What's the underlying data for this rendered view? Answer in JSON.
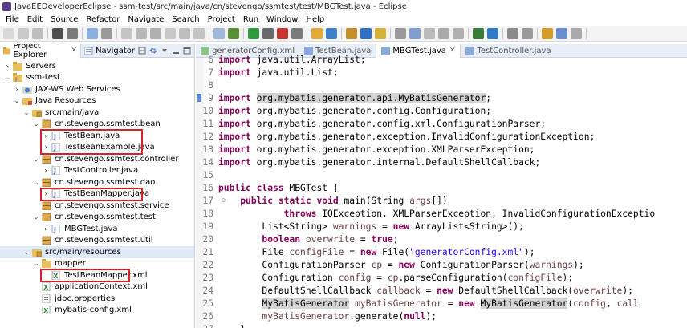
{
  "window": {
    "title": "JavaEEDeveloperEclipse - ssm-test/src/main/java/cn/stevengo/ssmtest/test/MBGTest.java - Eclipse"
  },
  "menu": [
    "File",
    "Edit",
    "Source",
    "Refactor",
    "Navigate",
    "Search",
    "Project",
    "Run",
    "Window",
    "Help"
  ],
  "left_panel": {
    "tabs": [
      {
        "label": "Project Explorer",
        "close": "✕"
      },
      {
        "label": "Navigator"
      }
    ],
    "tree": [
      {
        "label": "Servers",
        "twisty": "›",
        "icon": "folder"
      },
      {
        "label": "ssm-test",
        "twisty": "⌄",
        "icon": "project"
      },
      {
        "label": "JAX-WS Web Services",
        "twisty": "›",
        "icon": "ws"
      },
      {
        "label": "Java Resources",
        "twisty": "⌄",
        "icon": "jres"
      },
      {
        "label": "src/main/java",
        "twisty": "⌄",
        "icon": "srcfolder"
      },
      {
        "label": "cn.stevengo.ssmtest.bean",
        "twisty": "⌄",
        "icon": "package"
      },
      {
        "label": "TestBean.java",
        "twisty": "›",
        "icon": "java"
      },
      {
        "label": "TestBeanExample.java",
        "twisty": "›",
        "icon": "java"
      },
      {
        "label": "cn.stevengo.ssmtest.controller",
        "twisty": "⌄",
        "icon": "package"
      },
      {
        "label": "TestController.java",
        "twisty": "›",
        "icon": "java"
      },
      {
        "label": "cn.stevengo.ssmtest.dao",
        "twisty": "⌄",
        "icon": "package"
      },
      {
        "label": "TestBeanMapper.java",
        "twisty": "›",
        "icon": "java"
      },
      {
        "label": "cn.stevengo.ssmtest.service",
        "twisty": "",
        "icon": "package"
      },
      {
        "label": "cn.stevengo.ssmtest.test",
        "twisty": "⌄",
        "icon": "package"
      },
      {
        "label": "MBGTest.java",
        "twisty": "›",
        "icon": "java"
      },
      {
        "label": "cn.stevengo.ssmtest.util",
        "twisty": "",
        "icon": "package"
      },
      {
        "label": "src/main/resources",
        "twisty": "⌄",
        "icon": "srcfolder"
      },
      {
        "label": "mapper",
        "twisty": "⌄",
        "icon": "folder"
      },
      {
        "label": "TestBeanMapper.xml",
        "twisty": "",
        "icon": "xml"
      },
      {
        "label": "applicationContext.xml",
        "twisty": "",
        "icon": "xml"
      },
      {
        "label": "jdbc.properties",
        "twisty": "",
        "icon": "props"
      },
      {
        "label": "mybatis-config.xml",
        "twisty": "",
        "icon": "xml"
      }
    ]
  },
  "editor": {
    "tabs": [
      {
        "label": "generatorConfig.xml",
        "icon": "xml"
      },
      {
        "label": "TestBean.java",
        "icon": "java"
      },
      {
        "label": "MBGTest.java",
        "icon": "java",
        "close": "✕"
      },
      {
        "label": "TestController.java",
        "icon": "java"
      }
    ],
    "lines": [
      {
        "n": "6",
        "segs": [
          {
            "t": "import",
            "c": "kw"
          },
          {
            "t": " java.util.ArrayList;"
          }
        ]
      },
      {
        "n": "7",
        "segs": [
          {
            "t": "import",
            "c": "kw"
          },
          {
            "t": " java.util.List;"
          }
        ]
      },
      {
        "n": "8",
        "segs": []
      },
      {
        "n": "9",
        "segs": [
          {
            "t": "import",
            "c": "kw"
          },
          {
            "t": " "
          },
          {
            "t": "org.mybatis.generator.api.MyBatisGenerator",
            "c": "hl"
          },
          {
            "t": ";"
          }
        ]
      },
      {
        "n": "10",
        "segs": [
          {
            "t": "import",
            "c": "kw"
          },
          {
            "t": " org.mybatis.generator.config.Configuration;"
          }
        ]
      },
      {
        "n": "11",
        "segs": [
          {
            "t": "import",
            "c": "kw"
          },
          {
            "t": " org.mybatis.generator.config.xml.ConfigurationParser;"
          }
        ]
      },
      {
        "n": "12",
        "segs": [
          {
            "t": "import",
            "c": "kw"
          },
          {
            "t": " org.mybatis.generator.exception.InvalidConfigurationException;"
          }
        ]
      },
      {
        "n": "13",
        "segs": [
          {
            "t": "import",
            "c": "kw"
          },
          {
            "t": " org.mybatis.generator.exception.XMLParserException;"
          }
        ]
      },
      {
        "n": "14",
        "segs": [
          {
            "t": "import",
            "c": "kw"
          },
          {
            "t": " org.mybatis.generator.internal.DefaultShellCallback;"
          }
        ]
      },
      {
        "n": "15",
        "segs": []
      },
      {
        "n": "16",
        "segs": [
          {
            "t": "public",
            "c": "kw"
          },
          {
            "t": " "
          },
          {
            "t": "class",
            "c": "kw"
          },
          {
            "t": " MBGTest {"
          }
        ]
      },
      {
        "n": "17",
        "segs": [
          {
            "t": "    "
          },
          {
            "t": "public",
            "c": "kw"
          },
          {
            "t": " "
          },
          {
            "t": "static",
            "c": "kw"
          },
          {
            "t": " "
          },
          {
            "t": "void",
            "c": "kw"
          },
          {
            "t": " main(String "
          },
          {
            "t": "args",
            "c": "var"
          },
          {
            "t": "[])"
          }
        ]
      },
      {
        "n": "18",
        "segs": [
          {
            "t": "            "
          },
          {
            "t": "throws",
            "c": "kw"
          },
          {
            "t": " IOException, XMLParserException, InvalidConfigurationExceptio"
          }
        ]
      },
      {
        "n": "19",
        "segs": [
          {
            "t": "        List<String> "
          },
          {
            "t": "warnings",
            "c": "var"
          },
          {
            "t": " = "
          },
          {
            "t": "new",
            "c": "kw"
          },
          {
            "t": " ArrayList<String>();"
          }
        ]
      },
      {
        "n": "20",
        "segs": [
          {
            "t": "        "
          },
          {
            "t": "boolean",
            "c": "kw"
          },
          {
            "t": " "
          },
          {
            "t": "overwrite",
            "c": "var"
          },
          {
            "t": " = "
          },
          {
            "t": "true",
            "c": "kw"
          },
          {
            "t": ";"
          }
        ]
      },
      {
        "n": "21",
        "segs": [
          {
            "t": "        File "
          },
          {
            "t": "configFile",
            "c": "var"
          },
          {
            "t": " = "
          },
          {
            "t": "new",
            "c": "kw"
          },
          {
            "t": " File("
          },
          {
            "t": "\"generatorConfig.xml\"",
            "c": "str"
          },
          {
            "t": ");"
          }
        ]
      },
      {
        "n": "22",
        "segs": [
          {
            "t": "        ConfigurationParser "
          },
          {
            "t": "cp",
            "c": "var"
          },
          {
            "t": " = "
          },
          {
            "t": "new",
            "c": "kw"
          },
          {
            "t": " ConfigurationParser("
          },
          {
            "t": "warnings",
            "c": "var"
          },
          {
            "t": ");"
          }
        ]
      },
      {
        "n": "23",
        "segs": [
          {
            "t": "        Configuration "
          },
          {
            "t": "config",
            "c": "var"
          },
          {
            "t": " = "
          },
          {
            "t": "cp",
            "c": "var"
          },
          {
            "t": ".parseConfiguration("
          },
          {
            "t": "configFile",
            "c": "var"
          },
          {
            "t": ");"
          }
        ]
      },
      {
        "n": "24",
        "segs": [
          {
            "t": "        DefaultShellCallback "
          },
          {
            "t": "callback",
            "c": "var"
          },
          {
            "t": " = "
          },
          {
            "t": "new",
            "c": "kw"
          },
          {
            "t": " DefaultShellCallback("
          },
          {
            "t": "overwrite",
            "c": "var"
          },
          {
            "t": ");"
          }
        ]
      },
      {
        "n": "25",
        "segs": [
          {
            "t": "        "
          },
          {
            "t": "MyBatisGenerator",
            "c": "hl"
          },
          {
            "t": " "
          },
          {
            "t": "myBatisGenerator",
            "c": "var"
          },
          {
            "t": " = "
          },
          {
            "t": "new",
            "c": "kw"
          },
          {
            "t": " "
          },
          {
            "t": "MyBatisGenerator",
            "c": "hl"
          },
          {
            "t": "("
          },
          {
            "t": "config",
            "c": "var"
          },
          {
            "t": ", "
          },
          {
            "t": "call",
            "c": "var"
          }
        ]
      },
      {
        "n": "26",
        "segs": [
          {
            "t": "        "
          },
          {
            "t": "myBatisGenerator",
            "c": "var"
          },
          {
            "t": ".generate("
          },
          {
            "t": "null",
            "c": "kw"
          },
          {
            "t": ");"
          }
        ]
      },
      {
        "n": "27",
        "segs": [
          {
            "t": "    }"
          }
        ]
      }
    ]
  }
}
